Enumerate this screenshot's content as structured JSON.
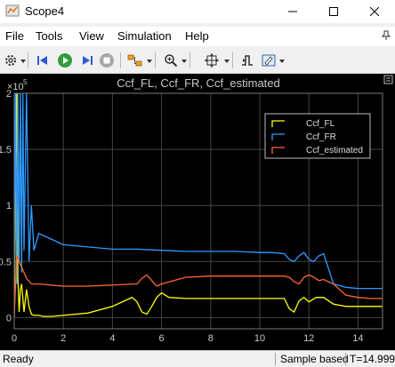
{
  "window": {
    "title": "Scope4"
  },
  "menu": {
    "items": [
      "File",
      "Tools",
      "View",
      "Simulation",
      "Help"
    ]
  },
  "toolbar": {
    "icons": [
      "settings-icon",
      "step-back-icon",
      "run-icon",
      "step-forward-icon",
      "stop-icon",
      "highlight-icon",
      "zoom-icon",
      "autoscale-icon",
      "triggers-icon",
      "cursor-measurement-icon"
    ]
  },
  "status": {
    "left": "Ready",
    "mode": "Sample based",
    "time": "T=14.999"
  },
  "colors": {
    "fl": "#ffff00",
    "fr": "#2e9bff",
    "est": "#ff6633",
    "axes_bg": "#000000",
    "grid": "#444444",
    "tick_text": "#c8c8c8"
  },
  "chart_data": {
    "type": "line",
    "title": "Ccf_FL, Ccf_FR, Ccf_estimated",
    "xlabel": "",
    "ylabel": "",
    "y_exponent_label": "×10",
    "y_exponent": "5",
    "xlim": [
      0,
      15
    ],
    "ylim": [
      -0.1,
      2.0
    ],
    "xticks": [
      0,
      2,
      4,
      6,
      8,
      10,
      12,
      14
    ],
    "yticks": [
      0,
      0.5,
      1,
      1.5,
      2
    ],
    "ytick_labels": [
      "0",
      "0.5",
      "1",
      "1.5",
      "2"
    ],
    "grid": true,
    "legend_position": "top-right",
    "series": [
      {
        "name": "Ccf_FL",
        "color": "#ffff00",
        "x": [
          0,
          0.05,
          0.1,
          0.15,
          0.2,
          0.25,
          0.3,
          0.4,
          0.5,
          0.6,
          0.7,
          0.8,
          1.0,
          1.2,
          1.5,
          2.0,
          3.0,
          4.0,
          4.5,
          4.8,
          5.0,
          5.2,
          5.4,
          5.6,
          5.8,
          6.0,
          6.3,
          7.0,
          8.0,
          9.0,
          10.0,
          10.5,
          11.0,
          11.2,
          11.4,
          11.6,
          11.8,
          12.0,
          12.3,
          12.6,
          13.0,
          13.5,
          14.0,
          14.5,
          15.0
        ],
        "y": [
          0.0,
          1.2,
          2.0,
          0.35,
          0.05,
          0.25,
          0.3,
          0.05,
          0.25,
          0.1,
          0.03,
          0.02,
          0.02,
          0.01,
          0.01,
          0.02,
          0.04,
          0.1,
          0.15,
          0.18,
          0.14,
          0.05,
          0.03,
          0.1,
          0.18,
          0.22,
          0.18,
          0.17,
          0.17,
          0.17,
          0.17,
          0.17,
          0.17,
          0.08,
          0.05,
          0.15,
          0.18,
          0.14,
          0.18,
          0.18,
          0.12,
          0.1,
          0.1,
          0.1,
          0.1
        ]
      },
      {
        "name": "Ccf_FR",
        "color": "#2e9bff",
        "x": [
          0,
          0.05,
          0.1,
          0.15,
          0.2,
          0.25,
          0.3,
          0.35,
          0.4,
          0.5,
          0.6,
          0.7,
          0.8,
          1.0,
          1.5,
          2.0,
          3.0,
          4.0,
          5.0,
          6.0,
          7.0,
          8.0,
          9.0,
          10.0,
          10.5,
          11.0,
          11.2,
          11.4,
          11.6,
          11.8,
          12.0,
          12.2,
          12.4,
          12.6,
          13.0,
          13.5,
          14.0,
          14.5,
          15.0
        ],
        "y": [
          0.2,
          2.0,
          0.3,
          2.0,
          0.5,
          2.0,
          0.4,
          2.0,
          0.6,
          2.0,
          0.5,
          1.0,
          0.6,
          0.75,
          0.7,
          0.65,
          0.63,
          0.61,
          0.61,
          0.6,
          0.59,
          0.59,
          0.59,
          0.58,
          0.58,
          0.57,
          0.52,
          0.5,
          0.55,
          0.58,
          0.52,
          0.5,
          0.55,
          0.57,
          0.3,
          0.27,
          0.26,
          0.26,
          0.26
        ]
      },
      {
        "name": "Ccf_estimated",
        "color": "#ff6633",
        "x": [
          0,
          0.1,
          0.2,
          0.3,
          0.4,
          0.5,
          0.7,
          1.0,
          1.5,
          2.0,
          3.0,
          4.0,
          5.0,
          5.2,
          5.4,
          5.6,
          5.8,
          6.0,
          7.0,
          8.0,
          9.0,
          10.0,
          10.5,
          11.0,
          11.2,
          11.4,
          11.6,
          11.8,
          12.0,
          12.2,
          12.4,
          12.6,
          13.0,
          13.5,
          14.0,
          14.5,
          15.0
        ],
        "y": [
          0.0,
          0.55,
          0.5,
          0.45,
          0.4,
          0.35,
          0.3,
          0.3,
          0.29,
          0.28,
          0.28,
          0.29,
          0.3,
          0.35,
          0.38,
          0.33,
          0.28,
          0.3,
          0.36,
          0.37,
          0.37,
          0.37,
          0.37,
          0.37,
          0.36,
          0.32,
          0.3,
          0.36,
          0.38,
          0.36,
          0.33,
          0.34,
          0.3,
          0.2,
          0.18,
          0.17,
          0.17
        ]
      }
    ]
  }
}
